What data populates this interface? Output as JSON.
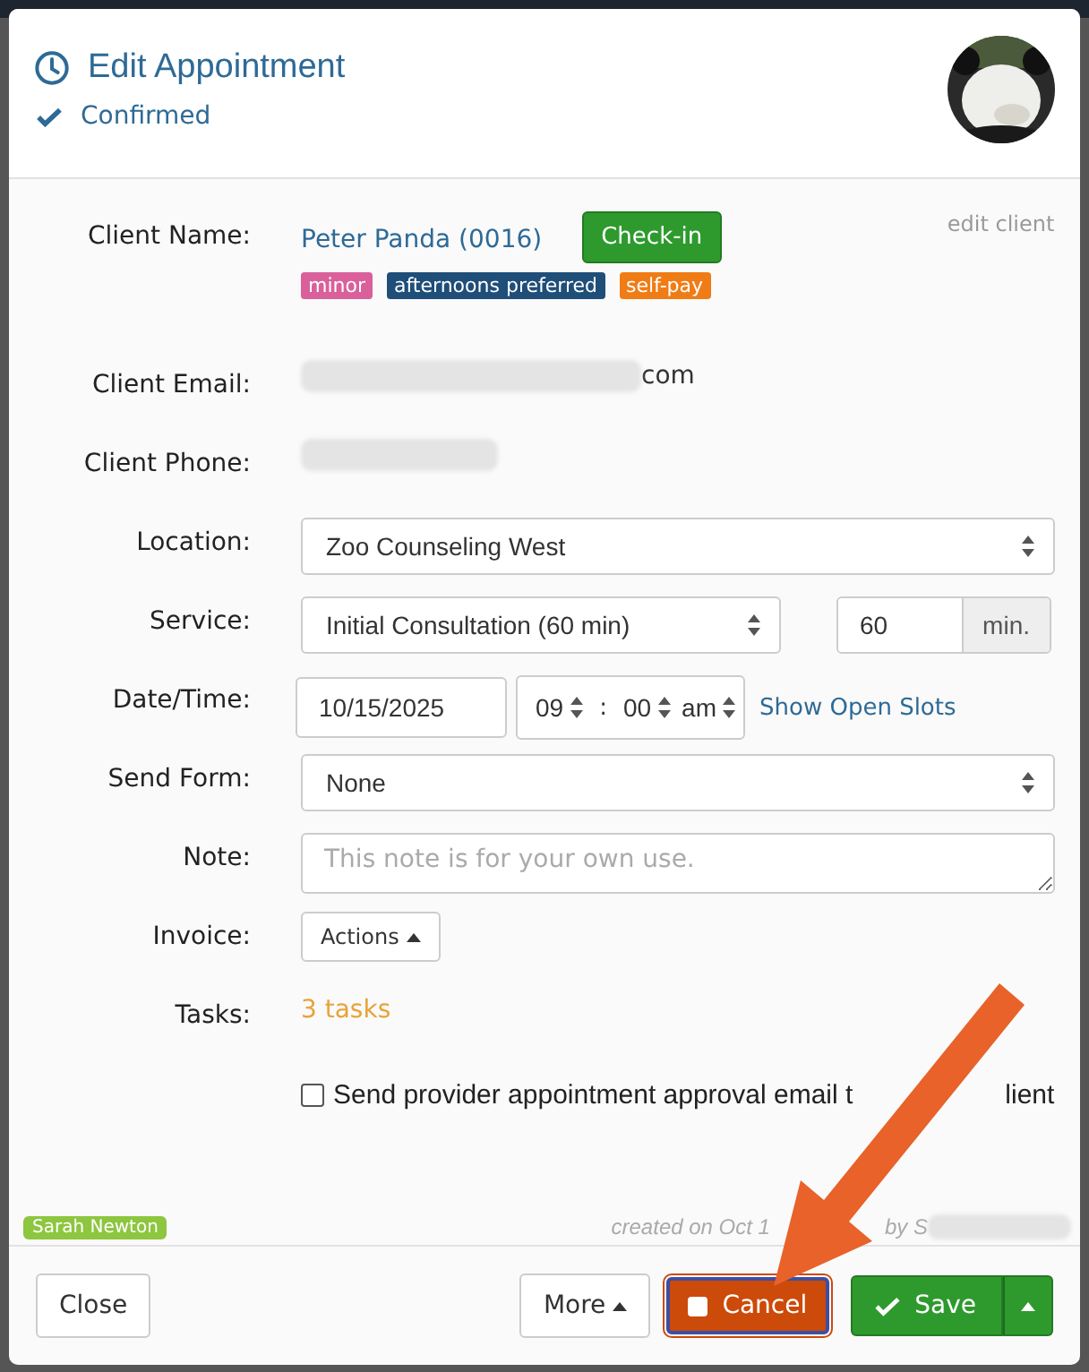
{
  "dialog": {
    "title": "Edit Appointment",
    "status": "Confirmed"
  },
  "rows": [
    {
      "kind": "client",
      "label": "Client Name:",
      "name": "Peter Panda (0016)",
      "action": "Check-in",
      "edit": "edit client",
      "tags": [
        {
          "label": "minor",
          "color": "#d9609b"
        },
        {
          "label": "afternoons preferred",
          "color": "#1f4e79"
        },
        {
          "label": "self-pay",
          "color": "#f07c16"
        }
      ]
    },
    {
      "kind": "redacted",
      "label": "Client Email:",
      "suffix": "com"
    },
    {
      "kind": "redacted",
      "label": "Client Phone:"
    },
    {
      "kind": "select",
      "label": "Location:",
      "value": "Zoo Counseling West"
    },
    {
      "kind": "service",
      "label": "Service:",
      "value": "Initial Consultation (60 min)",
      "duration": "60",
      "unit": "min."
    },
    {
      "kind": "datetime",
      "label": "Date/Time:",
      "date": "10/15/2025",
      "hour": "09",
      "separator": ":",
      "minute": "00",
      "ampm": "am",
      "link": "Show Open Slots"
    },
    {
      "kind": "select",
      "label": "Send Form:",
      "value": "None"
    },
    {
      "kind": "textarea",
      "label": "Note:",
      "placeholder": "This note is for your own use."
    },
    {
      "kind": "menu",
      "label": "Invoice:",
      "button": "Actions"
    },
    {
      "kind": "link",
      "label": "Tasks:",
      "text": "3 tasks"
    },
    {
      "kind": "checkbox",
      "text": "Send provider appointment approval email t",
      "text_after": "lient",
      "checked": false
    }
  ],
  "provider": {
    "label": "Sarah Newton",
    "color": "#8dc63f"
  },
  "created": {
    "before": "created on Oct 1",
    "after": "by S"
  },
  "buttons": [
    {
      "kind": "plain",
      "label": "Close"
    },
    {
      "kind": "menu",
      "label": "More"
    },
    {
      "kind": "cancel",
      "label": "Cancel"
    },
    {
      "kind": "save",
      "label": "Save"
    }
  ]
}
